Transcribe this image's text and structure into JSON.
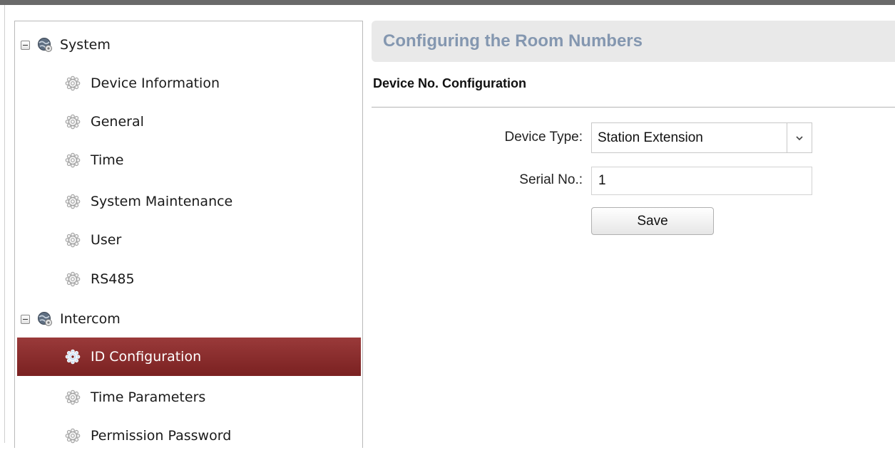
{
  "sidebar": {
    "groups": [
      {
        "label": "System",
        "items": [
          "Device Information",
          "General",
          "Time",
          "System Maintenance",
          "User",
          "RS485"
        ]
      },
      {
        "label": "Intercom",
        "items": [
          "ID Configuration",
          "Time Parameters",
          "Permission Password"
        ]
      }
    ],
    "selected": "ID Configuration"
  },
  "main": {
    "title": "Configuring the Room Numbers",
    "section_title": "Device No. Configuration",
    "device_type_label": "Device Type:",
    "device_type_value": "Station Extension",
    "serial_label": "Serial No.:",
    "serial_value": "1",
    "save_label": "Save"
  },
  "colors": {
    "selected_bg": "#8b2d2d",
    "title": "#8497b0",
    "header_bg": "#e9e9e9"
  }
}
